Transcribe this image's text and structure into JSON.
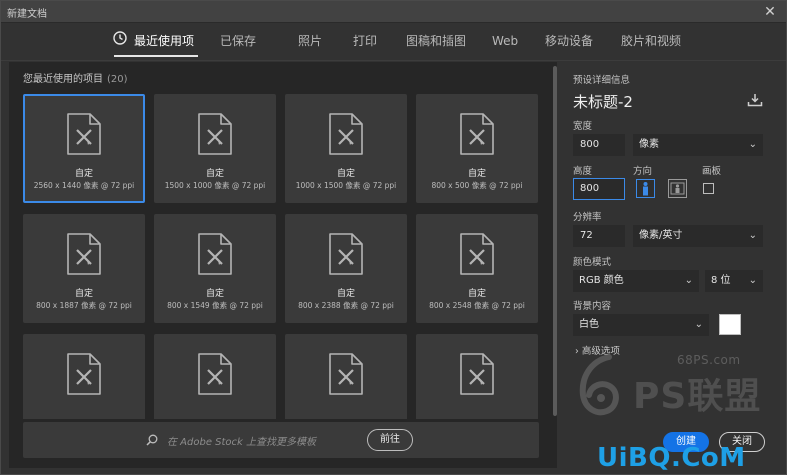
{
  "window": {
    "title": "新建文档",
    "close_glyph": "✕"
  },
  "tabs": [
    {
      "label": "最近使用项",
      "active": true
    },
    {
      "label": "已保存"
    },
    {
      "label": "照片"
    },
    {
      "label": "打印"
    },
    {
      "label": "图稿和插图"
    },
    {
      "label": "Web"
    },
    {
      "label": "移动设备"
    },
    {
      "label": "胶片和视频"
    }
  ],
  "recent": {
    "label": "您最近使用的项目",
    "count": "(20)",
    "items": [
      {
        "name": "自定",
        "dims": "2560 x 1440 像素 @ 72 ppi",
        "selected": true
      },
      {
        "name": "自定",
        "dims": "1500 x 1000 像素 @ 72 ppi"
      },
      {
        "name": "自定",
        "dims": "1000 x 1500 像素 @ 72 ppi"
      },
      {
        "name": "自定",
        "dims": "800 x 500 像素 @ 72 ppi"
      },
      {
        "name": "自定",
        "dims": "800 x 1887 像素 @ 72 ppi"
      },
      {
        "name": "自定",
        "dims": "800 x 1549 像素 @ 72 ppi"
      },
      {
        "name": "自定",
        "dims": "800 x 2388 像素 @ 72 ppi"
      },
      {
        "name": "自定",
        "dims": "800 x 2548 像素 @ 72 ppi"
      },
      {
        "name": "",
        "dims": ""
      },
      {
        "name": "",
        "dims": ""
      },
      {
        "name": "",
        "dims": ""
      },
      {
        "name": "",
        "dims": ""
      }
    ]
  },
  "search": {
    "placeholder": "在 Adobe Stock 上查找更多模板",
    "go_label": "前往"
  },
  "details": {
    "header": "预设详细信息",
    "doc_name": "未标题-2",
    "width_label": "宽度",
    "width_value": "800",
    "width_unit": "像素",
    "height_label": "高度",
    "height_value": "800",
    "orientation_label": "方向",
    "artboard_label": "画板",
    "resolution_label": "分辨率",
    "resolution_value": "72",
    "resolution_unit": "像素/英寸",
    "color_mode_label": "颜色模式",
    "color_mode_value": "RGB 颜色",
    "bit_depth_value": "8 位",
    "background_label": "背景内容",
    "background_value": "白色",
    "background_color": "#ffffff",
    "advanced_label": "高级选项"
  },
  "buttons": {
    "create": "创建",
    "close": "关闭"
  },
  "watermark": {
    "top": "68PS.com",
    "main": "PS联盟",
    "bottom": "UiBQ.CoM"
  },
  "colors": {
    "accent": "#1473e6",
    "selection": "#3b8ae8"
  }
}
